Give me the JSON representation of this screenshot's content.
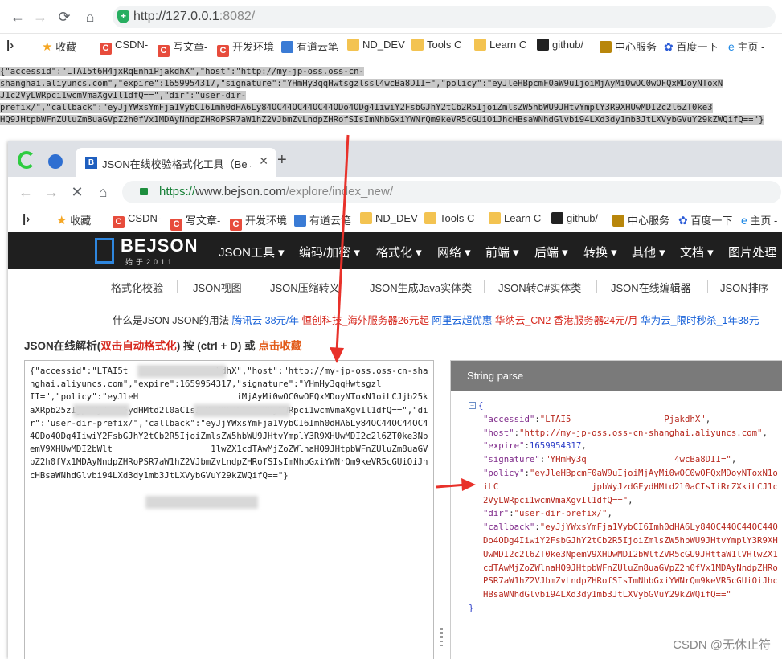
{
  "outer": {
    "url_host": "http://127.0.0.1",
    "url_port": ":8082/",
    "bookmarks": [
      "收藏",
      "CSDN-",
      "写文章-",
      "开发环境",
      "有道云笔",
      "ND_DEV",
      "Tools C",
      "Learn C",
      "github/",
      "中心服务",
      "百度一下",
      "主页 -"
    ],
    "json_lines": [
      "{\"accessid\":\"LTAI5t6H4jxRqEnhiPjakdhX\",\"host\":\"http://my-jp-oss.oss-cn-",
      "shanghai.aliyuncs.com\",\"expire\":1659954317,\"signature\":\"YHmHy3qqHwtsgzlssl4wcBa8DII=\",\"policy\":\"eyJleHBpcmF0aW9uIjoiMjAyMi0wOC0wOFQxMDoyNToxN",
      "J1c2VyLWRpci1wcmVmaXgvIl1dfQ==\",\"dir\":\"user-dir-",
      "prefix/\",\"callback\":\"eyJjYWxsYmFja1VybCI6Imh0dHA6Ly84OC44OC44OC44ODo4ODg4IiwiY2FsbGJhY2tCb2R5IjoiZmlsZW5hbWU9JHtvYmplY3R9XHUwMDI2c2l6ZT0ke3",
      "HQ9JHtpbWFnZUluZm8uaGVpZ2h0fVx1MDAyNndpZHRoPSR7aW1hZ2VJbmZvLndpZHRofSIsImNhbGxiYWNrQm9keVR5cGUiOiJhcHBsaWNhdGlvbi94LXd3dy1mb3JtLXVybGVuY29kZWQifQ==\"}"
    ]
  },
  "inner": {
    "tab_title": "JSON在线校验格式化工具（Be J",
    "url_scheme": "https://",
    "url_host": "www.bejson.com",
    "url_path": "/explore/index_new/",
    "bookmarks": [
      "收藏",
      "CSDN-",
      "写文章-",
      "开发环境",
      "有道云笔",
      "ND_DEV",
      "Tools C",
      "Learn C",
      "github/",
      "中心服务",
      "百度一下",
      "主页 -"
    ],
    "logo": "BEJSON",
    "logo_sub": "始于2011",
    "nav": [
      "JSON工具 ▾",
      "编码/加密 ▾",
      "格式化 ▾",
      "网络 ▾",
      "前端 ▾",
      "后端 ▾",
      "转换 ▾",
      "其他 ▾",
      "文档 ▾",
      "图片处理"
    ],
    "subnav": [
      "格式化校验",
      "JSON视图",
      "JSON压缩转义",
      "JSON生成Java实体类",
      "JSON转C#实体类",
      "JSON在线编辑器",
      "JSON排序"
    ],
    "ad_prefix": "什么是JSON JSON的用法",
    "ad_links": [
      "腾讯云 38元/年",
      "恒创科技_海外服务器26元起",
      "阿里云超优惠",
      "华纳云_CN2 香港服务器24元/月",
      "华为云_限时秒杀_1年38元"
    ],
    "parse_title_a": "JSON在线解析(",
    "parse_title_b": "双击自动格式化",
    "parse_title_c": ")  按 (ctrl + D) 或 ",
    "parse_title_d": "点击收藏",
    "editor_text": "{\"accessid\":\"LTAI5t                akdhX\",\"host\":\"http://my-jp-oss.oss-cn-shanghai.aliyuncs.com\",\"expire\":1659954317,\"signature\":\"YHmHy3qqHwtsgzl            II=\",\"policy\":\"eyJleH                   iMjAyMi0wOC0wOFQxMDoyNToxN1oiLCJjb25kaXRpb25zIjpbWyJzdGFydHMtd2l0aCIsIiRrZXkiLCJ1c2VyLWRpci1wcmVmaXgvIl1dfQ==\",\"dir\":\"user-dir-prefix/\",\"callback\":\"eyJjYWxsYmFja1VybCI6Imh0dHA6Ly84OC44OC44OC44ODo4ODg4IiwiY2FsbGJhY2tCb2R5IjoiZmlsZW5hbWU9JHtvYmplY3R9XHUwMDI2c2l6ZT0ke3NpemV9XHUwMDI2bWlt                   1lwZX1cdTAwMjZoZWlnaHQ9JHtpbWFnZUluZm8uaGVpZ2h0fVx1MDAyNndpZHRoPSR7aW1hZ2VJbmZvLndpZHRofSIsImNhbGxiYWNrQm9keVR5cGUiOiJhcHBsaWNhdGlvbi94LXd3dy1mb3JtLXVybGVuY29kZWQifQ==\"}",
    "parse_header": "String parse",
    "parsed": [
      {
        "k": "\"accessid\"",
        "v": "\"LTAI5                  PjakdhX\"",
        "cls": "v"
      },
      {
        "k": "\"host\"",
        "v": "\"http://my-jp-oss.oss-cn-shanghai.aliyuncs.com\"",
        "cls": "v"
      },
      {
        "k": "\"expire\"",
        "v": "1659954317",
        "cls": "n"
      },
      {
        "k": "\"signature\"",
        "v": "\"YHmHy3q                 4wcBa8DII=\"",
        "cls": "v"
      },
      {
        "k": "\"policy\"",
        "v": "\"eyJleHBpcmF0aW9uIjoiMjAyMi0wOC0wOFQxMDoyNToxN1oiLC                  jpbWyJzdGFydHMtd2l0aCIsIiRrZXkiLCJ1c2VyLWRpci1wcmVmaXgvIl1dfQ==\"",
        "cls": "v"
      },
      {
        "k": "\"dir\"",
        "v": "\"user-dir-prefix/\"",
        "cls": "v"
      },
      {
        "k": "\"callback\"",
        "v": "\"eyJjYWxsYmFja1VybCI6Imh0dHA6Ly84OC44OC44OC44ODo4ODg4IiwiY2FsbGJhY2tCb2R5IjoiZmlsZW5hbWU9JHtvYmplY3R9XHUwMDI2c2l6ZT0ke3NpemV9XHUwMDI2bWltZVR5cGU9JHttaW1lVHlwZX1cdTAwMjZoZWlnaHQ9JHtpbWFnZUluZm8uaGVpZ2h0fVx1MDAyNndpZHRoPSR7aW1hZ2VJbmZvLndpZHRofSIsImNhbGxiYWNrQm9keVR5cGUiOiJhcHBsaWNhdGlvbi94LXd3dy1mb3JtLXVybGVuY29kZWQifQ==\"",
        "cls": "v"
      }
    ]
  },
  "watermark": "CSDN @无休止符",
  "colors": {
    "arrow": "#e8312a",
    "nav_bg": "#1f1f1f",
    "accent": "#2e86de"
  }
}
